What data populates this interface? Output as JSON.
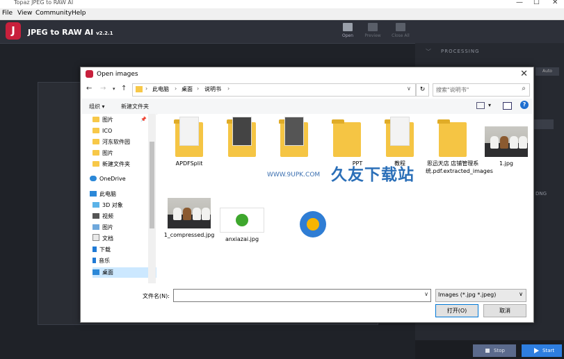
{
  "window": {
    "title": "Topaz JPEG to RAW AI",
    "min": "—",
    "max": "☐",
    "close": "✕"
  },
  "menu": [
    "File",
    "View",
    "Community",
    "Help"
  ],
  "app": {
    "logo_letter": "J",
    "title": "JPEG to RAW AI",
    "version": "v2.2.1",
    "toolbar": [
      {
        "label": "Open",
        "enabled": true
      },
      {
        "label": "Preview",
        "enabled": false
      },
      {
        "label": "Close All",
        "enabled": false
      }
    ],
    "processing_label": "PROCESSING",
    "auto_label": "Auto",
    "format_label": "DNG",
    "stop_label": "Stop",
    "start_label": "Start"
  },
  "dialog": {
    "title": "Open images",
    "breadcrumb": [
      "此电脑",
      "桌面",
      "说明书"
    ],
    "search_placeholder": "搜索\"说明书\"",
    "organize_label": "组织 ▾",
    "new_folder_label": "新建文件夹",
    "nav_items": [
      {
        "label": "图片",
        "icon": "folder",
        "selected": false
      },
      {
        "label": "ICO",
        "icon": "folder",
        "selected": false
      },
      {
        "label": "河东软件园",
        "icon": "folder",
        "selected": false
      },
      {
        "label": "图片",
        "icon": "folder",
        "selected": false
      },
      {
        "label": "新建文件夹",
        "icon": "folder",
        "selected": false
      },
      {
        "label": "OneDrive",
        "icon": "cloud",
        "selected": false
      },
      {
        "label": "此电脑",
        "icon": "computer",
        "selected": false
      },
      {
        "label": "3D 对象",
        "icon": "cube",
        "selected": false
      },
      {
        "label": "视频",
        "icon": "video",
        "selected": false
      },
      {
        "label": "图片",
        "icon": "picture",
        "selected": false
      },
      {
        "label": "文档",
        "icon": "document",
        "selected": false
      },
      {
        "label": "下载",
        "icon": "download",
        "selected": false
      },
      {
        "label": "音乐",
        "icon": "music",
        "selected": false
      },
      {
        "label": "桌面",
        "icon": "desktop",
        "selected": true
      }
    ],
    "files": [
      {
        "name": "APDFSplit",
        "kind": "folder"
      },
      {
        "name": "",
        "kind": "folder"
      },
      {
        "name": "",
        "kind": "folder"
      },
      {
        "name": "PPT",
        "kind": "folder"
      },
      {
        "name": "教程",
        "kind": "folder"
      },
      {
        "name": "思迅天店 店铺管理系统.pdf.extracted_images",
        "kind": "folder"
      },
      {
        "name": "1.jpg",
        "kind": "photo"
      },
      {
        "name": "1_compressed.jpg",
        "kind": "photo"
      },
      {
        "name": "anxiazai.jpg",
        "kind": "melon"
      }
    ],
    "watermark": "久友下载站",
    "watermark_url": "WWW.9UPK.COM",
    "filename_label": "文件名(N):",
    "filename_value": "",
    "filter_value": "Images (*.jpg *.jpeg)",
    "open_label": "打开(O)",
    "cancel_label": "取消"
  }
}
